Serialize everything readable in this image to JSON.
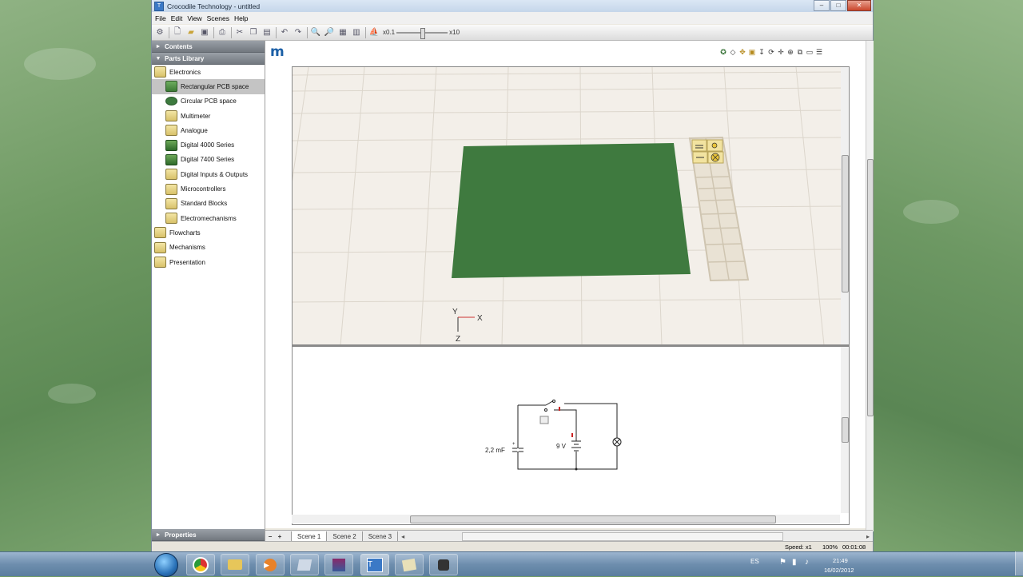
{
  "window": {
    "title": "Crocodile Technology - untitled",
    "app_icon": "T"
  },
  "menu": [
    "File",
    "Edit",
    "View",
    "Scenes",
    "Help"
  ],
  "toolbar": {
    "zoom_min_label": "x0.1",
    "zoom_max_label": "x10"
  },
  "sidebar": {
    "contents_label": "Contents",
    "parts_library_label": "Parts Library",
    "items": [
      {
        "label": "Electronics",
        "level": 0,
        "icon": "electronics-icon"
      },
      {
        "label": "Rectangular PCB space",
        "level": 1,
        "icon": "rect-pcb-icon",
        "selected": true
      },
      {
        "label": "Circular PCB space",
        "level": 1,
        "icon": "circular-pcb-icon"
      },
      {
        "label": "Multimeter",
        "level": 1,
        "icon": "multimeter-icon"
      },
      {
        "label": "Analogue",
        "level": 1,
        "icon": "analogue-icon"
      },
      {
        "label": "Digital 4000 Series",
        "level": 1,
        "icon": "chip-icon"
      },
      {
        "label": "Digital 7400 Series",
        "level": 1,
        "icon": "chip-icon"
      },
      {
        "label": "Digital Inputs & Outputs",
        "level": 1,
        "icon": "digital-io-icon"
      },
      {
        "label": "Microcontrollers",
        "level": 1,
        "icon": "microcontroller-icon"
      },
      {
        "label": "Standard Blocks",
        "level": 1,
        "icon": "blocks-icon"
      },
      {
        "label": "Electromechanisms",
        "level": 1,
        "icon": "electromechanism-icon"
      },
      {
        "label": "Flowcharts",
        "level": 0,
        "icon": "flowchart-icon"
      },
      {
        "label": "Mechanisms",
        "level": 0,
        "icon": "mechanism-icon"
      },
      {
        "label": "Presentation",
        "level": 0,
        "icon": "presentation-icon"
      }
    ],
    "properties_label": "Properties"
  },
  "view3d": {
    "axis_x": "X",
    "axis_y": "Y",
    "axis_z": "Z",
    "board_color": "#3f7a3f"
  },
  "schematic": {
    "capacitor_label": "2,2 mF",
    "battery_label": "9 V"
  },
  "tabs": {
    "add": "+",
    "remove": "−",
    "items": [
      "Scene 1",
      "Scene 2",
      "Scene 3"
    ],
    "active": 0
  },
  "status": {
    "speed": "Speed: x1",
    "zoom": "100%",
    "time": "00:01:08"
  },
  "taskbar": {
    "lang": "ES",
    "clock_time": "21:49",
    "clock_date": "16/02/2012"
  },
  "colors": {
    "accent": "#1b5fa6",
    "pcb_green": "#3f7a3f",
    "grid_bg": "#f3efe9"
  }
}
